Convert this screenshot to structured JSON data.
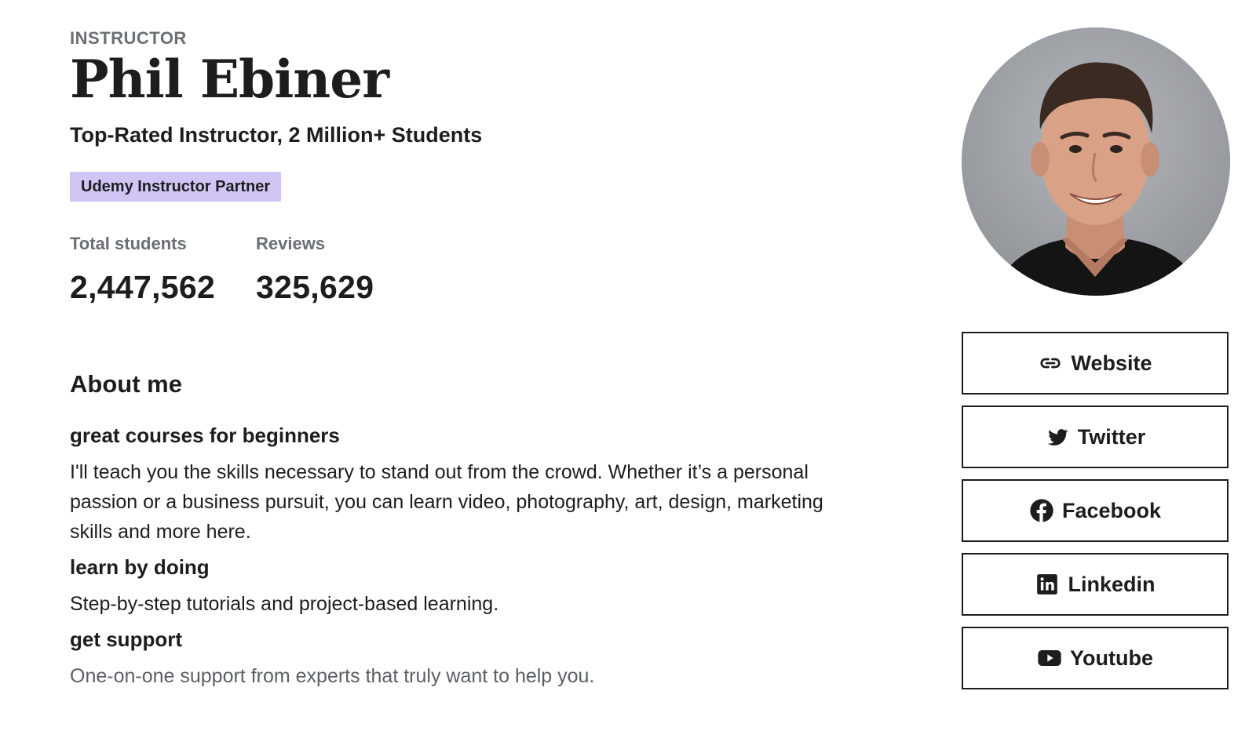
{
  "profile": {
    "eyebrow": "INSTRUCTOR",
    "name": "Phil Ebiner",
    "headline": "Top-Rated Instructor, 2 Million+ Students",
    "badge": "Udemy Instructor Partner"
  },
  "stats": {
    "students_label": "Total students",
    "students_value": "2,447,562",
    "reviews_label": "Reviews",
    "reviews_value": "325,629"
  },
  "about": {
    "title": "About me",
    "sections": [
      {
        "heading": "great courses for beginners",
        "body": "I'll teach you the skills necessary to stand out from the crowd. Whether it’s a personal passion or a business pursuit, you can learn video, photography, art, design, marketing skills and more here."
      },
      {
        "heading": "learn by doing",
        "body": "Step-by-step tutorials and project-based learning."
      },
      {
        "heading": "get support",
        "body": "One-on-one support from experts that truly want to help you."
      }
    ]
  },
  "social_links": [
    {
      "label": "Website",
      "icon": "link-icon"
    },
    {
      "label": "Twitter",
      "icon": "twitter-icon"
    },
    {
      "label": "Facebook",
      "icon": "facebook-icon"
    },
    {
      "label": "Linkedin",
      "icon": "linkedin-icon"
    },
    {
      "label": "Youtube",
      "icon": "youtube-icon"
    }
  ],
  "colors": {
    "text": "#1c1d1f",
    "muted": "#6a6f73",
    "badge_bg": "#d1c5f5",
    "avatar_bg": "#9c9fa4"
  }
}
